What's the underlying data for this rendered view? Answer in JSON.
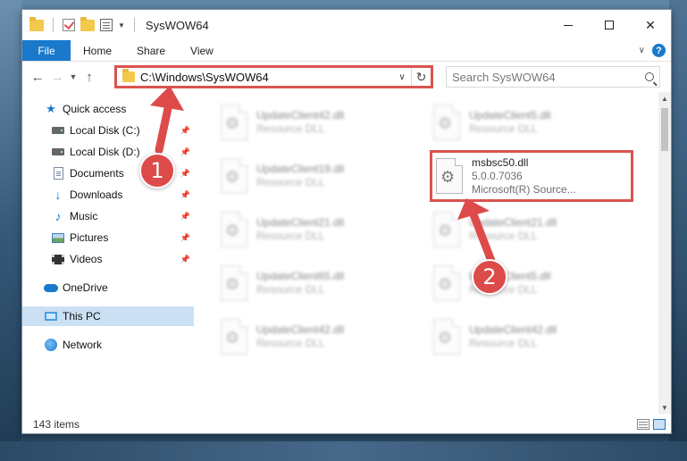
{
  "window": {
    "title": "SysWOW64"
  },
  "ribbon": {
    "tabs": [
      "File",
      "Home",
      "Share",
      "View"
    ]
  },
  "address": {
    "path": "C:\\Windows\\SysWOW64"
  },
  "search": {
    "placeholder": "Search SysWOW64"
  },
  "sidebar": {
    "items": [
      {
        "label": "Quick access",
        "icon": "star-icon"
      },
      {
        "label": "Local Disk (C:)",
        "icon": "disk-icon",
        "pinned": true
      },
      {
        "label": "Local Disk (D:)",
        "icon": "disk-icon",
        "pinned": true
      },
      {
        "label": "Documents",
        "icon": "documents-icon",
        "pinned": true
      },
      {
        "label": "Downloads",
        "icon": "download-icon",
        "pinned": true
      },
      {
        "label": "Music",
        "icon": "music-icon",
        "pinned": true
      },
      {
        "label": "Pictures",
        "icon": "pictures-icon",
        "pinned": true
      },
      {
        "label": "Videos",
        "icon": "videos-icon",
        "pinned": true
      },
      {
        "label": "OneDrive",
        "icon": "onedrive-icon"
      },
      {
        "label": "This PC",
        "icon": "computer-icon",
        "selected": true
      },
      {
        "label": "Network",
        "icon": "network-icon"
      }
    ]
  },
  "files": [
    {
      "name": "UpdateClient42.dll",
      "sub1": "Resource DLL",
      "sub2": "",
      "blurred": true
    },
    {
      "name": "UpdateClient5.dll",
      "sub1": "Resource DLL",
      "sub2": "",
      "blurred": true
    },
    {
      "name": "UpdateClient19.dll",
      "sub1": "Resource DLL",
      "sub2": "",
      "blurred": true
    },
    {
      "name": "msbsc50.dll",
      "sub1": "5.0.0.7036",
      "sub2": "Microsoft(R) Source...",
      "blurred": false
    },
    {
      "name": "UpdateClient21.dll",
      "sub1": "Resource DLL",
      "sub2": "",
      "blurred": true
    },
    {
      "name": "UpdateClient21.dll",
      "sub1": "Resource DLL",
      "sub2": "",
      "blurred": true
    },
    {
      "name": "UpdateClient65.dll",
      "sub1": "Resource DLL",
      "sub2": "",
      "blurred": true
    },
    {
      "name": "UpdateClient5.dll",
      "sub1": "Resource DLL",
      "sub2": "",
      "blurred": true
    },
    {
      "name": "UpdateClient42.dll",
      "sub1": "Resource DLL",
      "sub2": "",
      "blurred": true
    },
    {
      "name": "UpdateClient42.dll",
      "sub1": "Resource DLL",
      "sub2": "",
      "blurred": true
    }
  ],
  "status": {
    "item_count": "143 items"
  },
  "annotations": {
    "step1": "1",
    "step2": "2"
  },
  "colors": {
    "accent": "#1979ca",
    "highlight": "#d9534f",
    "selected_bg": "#cce0f4"
  }
}
